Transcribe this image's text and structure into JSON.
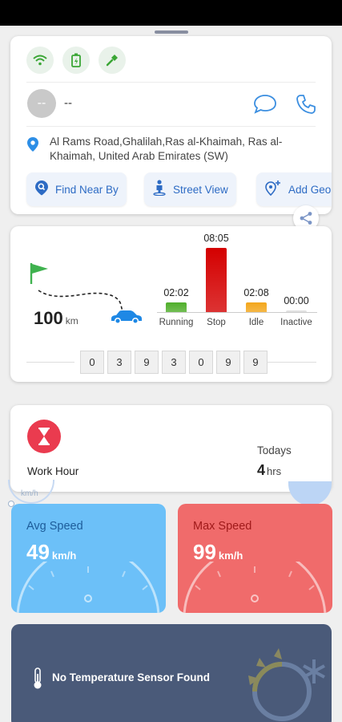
{
  "driver": {
    "avatar_text": "--",
    "name": "--"
  },
  "location": {
    "address": "Al Rams Road,Ghalilah,Ras al-Khaimah, Ras al-Khaimah, United Arab Emirates (SW)"
  },
  "actions": [
    {
      "label": "Find Near By",
      "icon": "search-location-icon"
    },
    {
      "label": "Street View",
      "icon": "person-pin-icon"
    },
    {
      "label": "Add Geo",
      "icon": "add-location-icon"
    }
  ],
  "trip": {
    "distance_value": "100",
    "distance_unit": "km",
    "odometer_digits": [
      "0",
      "3",
      "9",
      "3",
      "0",
      "9",
      "9"
    ],
    "bars": [
      {
        "label": "Running",
        "time": "02:02",
        "color": "#4fae2a",
        "level": 0.15
      },
      {
        "label": "Stop",
        "time": "08:05",
        "color": "#d40000",
        "level": 1.0
      },
      {
        "label": "Idle",
        "time": "02:08",
        "color": "#f3a61a",
        "level": 0.15
      },
      {
        "label": "Inactive",
        "time": "00:00",
        "color": "#dddddd",
        "level": 0.0
      }
    ]
  },
  "work_hour": {
    "label": "Work Hour",
    "today_label": "Todays",
    "today_value": "4",
    "today_unit": "hrs"
  },
  "speed": {
    "avg": {
      "title": "Avg Speed",
      "value": "49",
      "unit": "km/h",
      "color": "#6cc0f8"
    },
    "max": {
      "title": "Max Speed",
      "value": "99",
      "unit": "km/h",
      "color": "#f06b6b"
    },
    "ghost_unit": "km/h"
  },
  "temperature": {
    "message": "No Temperature Sensor Found"
  },
  "colors": {
    "accent": "#2d6bc4",
    "work_hour": "#ea3b4f",
    "temp_bg": "#4a5a79"
  }
}
